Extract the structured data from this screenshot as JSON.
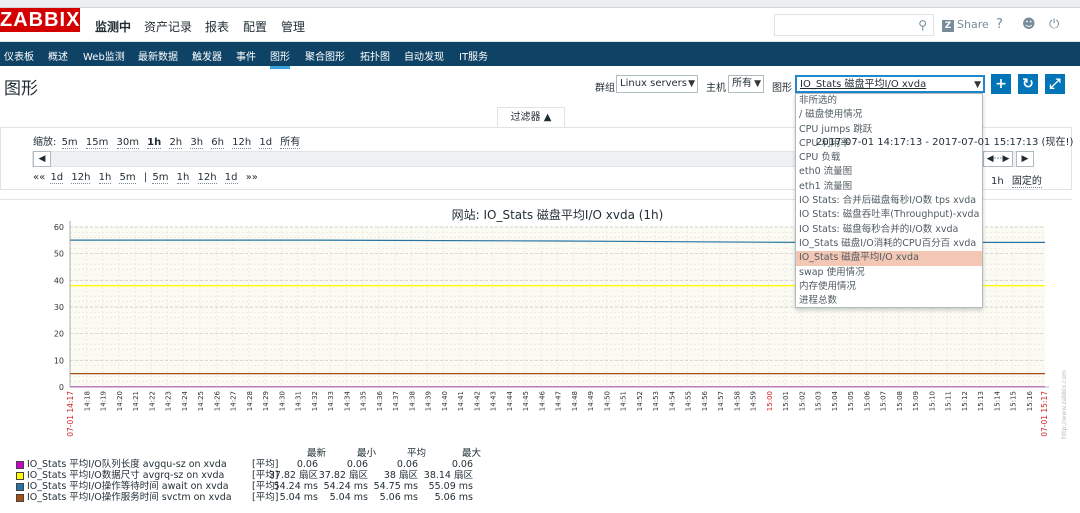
{
  "app": {
    "logo": "ZABBIX"
  },
  "main_nav": [
    "监测中",
    "资产记录",
    "报表",
    "配置",
    "管理"
  ],
  "header_tools": {
    "share": "Share",
    "help": "?",
    "user": "user-icon",
    "logout": "power-icon",
    "search_placeholder": ""
  },
  "sub_nav": [
    "仪表板",
    "概述",
    "Web监测",
    "最新数据",
    "触发器",
    "事件",
    "图形",
    "聚合图形",
    "拓扑图",
    "自动发现",
    "IT服务"
  ],
  "page": {
    "title": "图形"
  },
  "controls": {
    "group_label": "群组",
    "group_value": "Linux servers",
    "host_label": "主机",
    "host_value": "所有",
    "graph_label": "图形",
    "graph_value": "IO_Stats 磁盘平均I/O xvda"
  },
  "filter": {
    "tab": "过滤器 ▲",
    "zoom_label": "缩放:",
    "zoom": [
      "5m",
      "15m",
      "30m",
      "1h",
      "2h",
      "3h",
      "6h",
      "12h",
      "1d",
      "所有"
    ],
    "zoom_active": "1h",
    "nav_back": [
      "««",
      "1d",
      "12h",
      "1h",
      "5m",
      "|",
      "5m",
      "1h",
      "12h",
      "1d",
      "»»"
    ],
    "time_range": "2017-07-01 14:17:13 - 2017-07-01 15:17:13 (现在!)",
    "period": "1h",
    "fixed": "固定的"
  },
  "dropdown": {
    "items": [
      "非所选的",
      "/ 磁盘使用情况",
      "CPU jumps 跳跃",
      "CPU 利用率",
      "CPU 负载",
      "eth0 流量图",
      "eth1 流量图",
      "IO Stats: 合并后磁盘每秒I/O数 tps xvda",
      "IO Stats: 磁盘吞吐率(Throughput)-xvda",
      "IO Stats: 磁盘每秒合并的I/O数 xvda",
      "IO_Stats 磁盘I/O消耗的CPU百分百 xvda",
      "IO_Stats 磁盘平均I/O xvda",
      "swap 使用情况",
      "内存使用情况",
      "进程总数"
    ],
    "selected_index": 11
  },
  "chart_data": {
    "type": "line",
    "title": "网站: IO_Stats 磁盘平均I/O  xvda (1h)",
    "ylim": [
      0,
      60
    ],
    "yticks": [
      0,
      10,
      20,
      30,
      40,
      50,
      60
    ],
    "x_start_label": "07-01 14:17",
    "x_end_label": "07-01 15:17",
    "x_ticks": [
      "14:18",
      "14:19",
      "14:20",
      "14:21",
      "14:22",
      "14:23",
      "14:24",
      "14:25",
      "14:26",
      "14:27",
      "14:28",
      "14:29",
      "14:30",
      "14:31",
      "14:32",
      "14:33",
      "14:34",
      "14:35",
      "14:36",
      "14:37",
      "14:38",
      "14:39",
      "14:40",
      "14:41",
      "14:42",
      "14:43",
      "14:44",
      "14:45",
      "14:46",
      "14:47",
      "14:48",
      "14:49",
      "14:50",
      "14:51",
      "14:52",
      "14:53",
      "14:54",
      "14:55",
      "14:56",
      "14:57",
      "14:58",
      "14:59",
      "15:00",
      "15:01",
      "15:02",
      "15:03",
      "15:04",
      "15:05",
      "15:06",
      "15:07",
      "15:08",
      "15:09",
      "15:10",
      "15:11",
      "15:12",
      "15:13",
      "15:14",
      "15:15",
      "15:16"
    ],
    "highlight_tick": "15:00",
    "series": [
      {
        "name": "IO_Stats 平均I/O队列长度 avgqu-sz on xvda",
        "color": "#cc00cc",
        "values": [
          0.06,
          0.06
        ]
      },
      {
        "name": "IO_Stats 平均I/O数据尺寸 avgrq-sz on xvda",
        "color": "#ffff00",
        "values": [
          38,
          38
        ]
      },
      {
        "name": "IO_Stats 平均I/O操作等待时间 await on xvda",
        "color": "#2774a4",
        "values": [
          55.09,
          55.09,
          54.75,
          54.24,
          54.24
        ]
      },
      {
        "name": "IO_Stats 平均I/O操作服务时间 svctm on xvda",
        "color": "#a54f10",
        "values": [
          5.04,
          5.04
        ]
      }
    ],
    "legend_headers": [
      "最新",
      "最小",
      "平均",
      "最大"
    ],
    "legend_rows": [
      {
        "label": "IO_Stats  平均I/O队列长度  avgqu-sz on xvda",
        "func": "[平均]",
        "last": "0.06",
        "min": "0.06",
        "avg": "0.06",
        "max": "0.06",
        "color": "#cc00cc"
      },
      {
        "label": "IO_Stats  平均I/O数据尺寸  avgrq-sz on xvda",
        "func": "[平均]",
        "last": "37.82 扇区",
        "min": "37.82 扇区",
        "avg": "38 扇区",
        "max": "38.14 扇区",
        "color": "#ffff00"
      },
      {
        "label": "IO_Stats  平均I/O操作等待时间  await on xvda",
        "func": "[平均]",
        "last": "54.24 ms",
        "min": "54.24 ms",
        "avg": "54.75 ms",
        "max": "55.09 ms",
        "color": "#2774a4"
      },
      {
        "label": "IO_Stats  平均I/O操作服务时间  svctm on xvda",
        "func": "[平均]",
        "last": "5.04 ms",
        "min": "5.04 ms",
        "avg": "5.06 ms",
        "max": "5.06 ms",
        "color": "#a54f10"
      }
    ],
    "watermark": "http://www.zabbix.com"
  }
}
